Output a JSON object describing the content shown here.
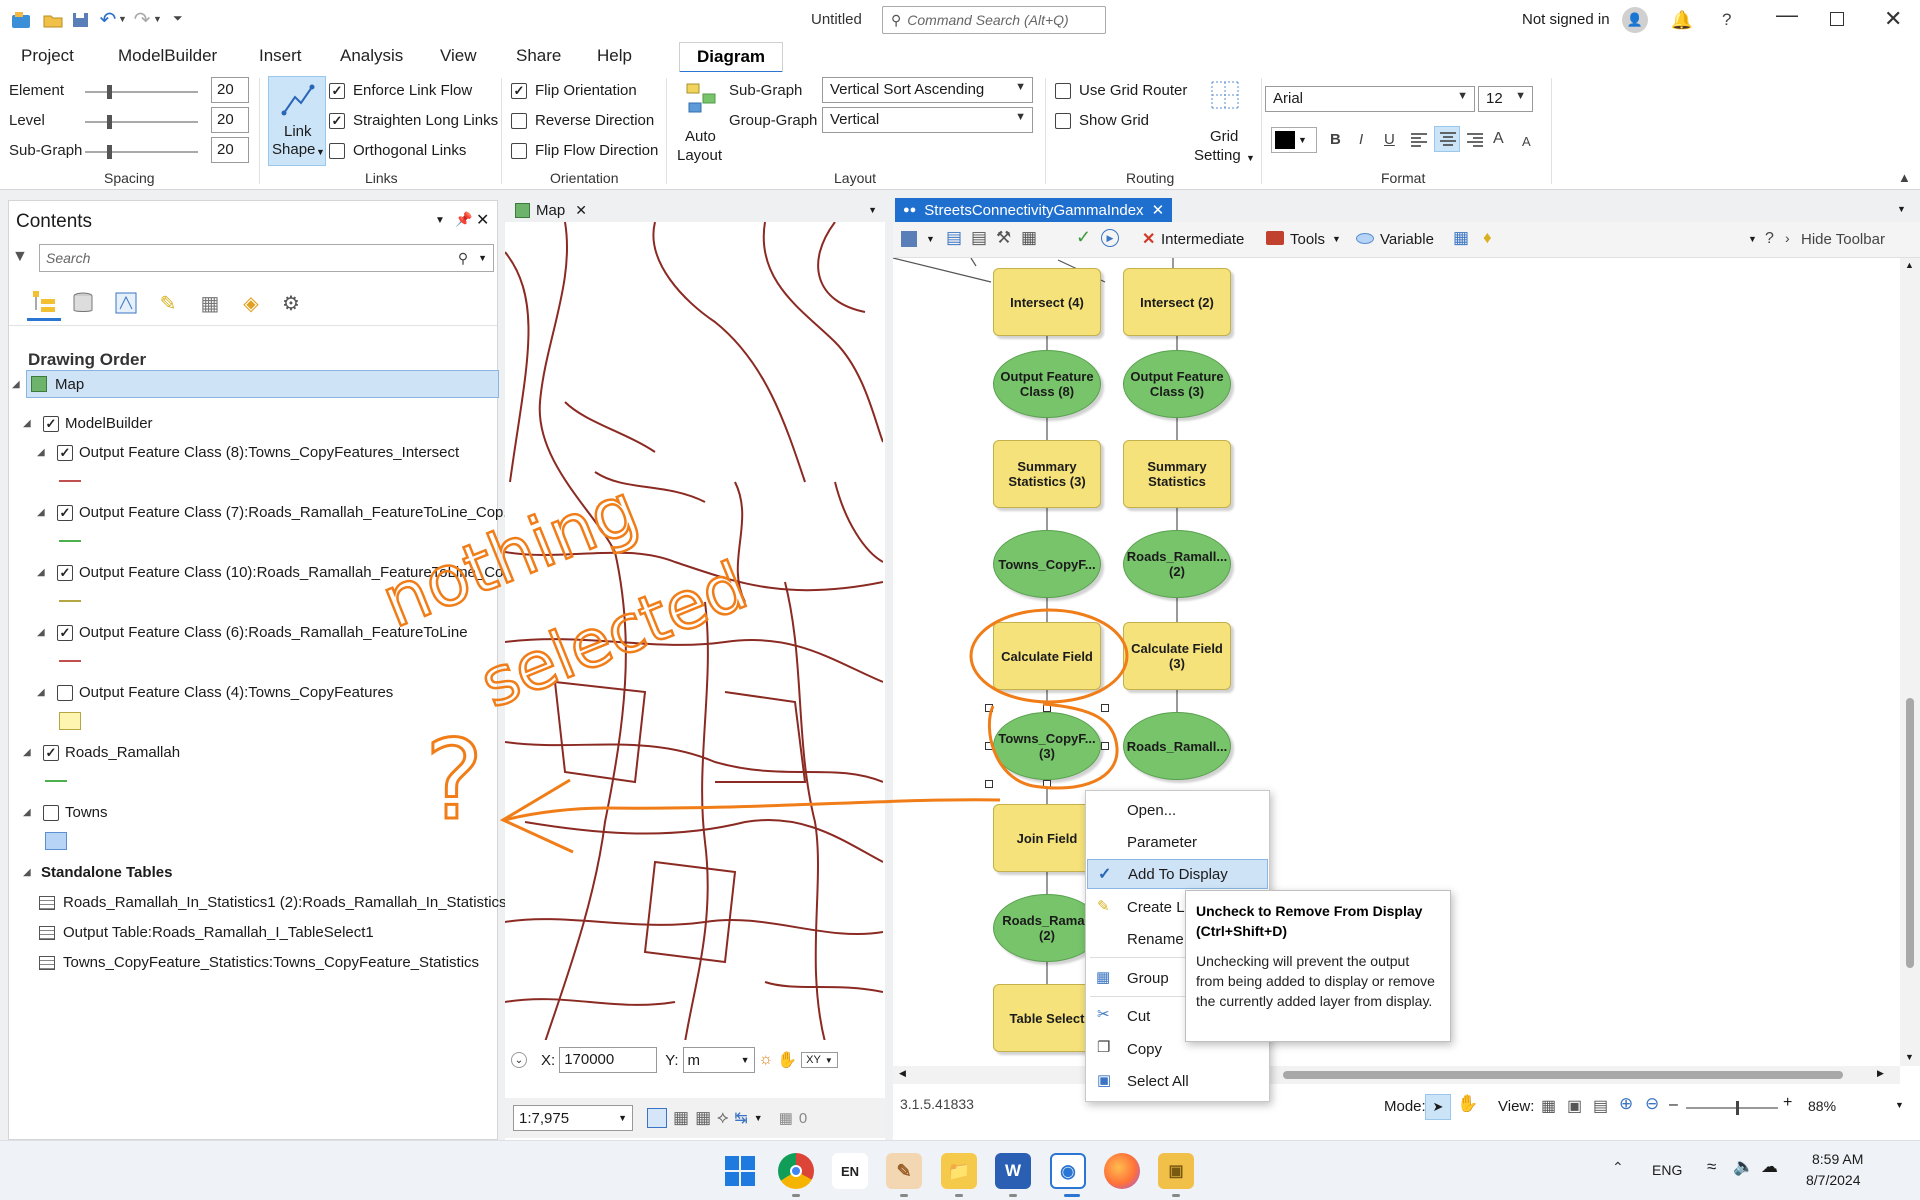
{
  "titlebar": {
    "doc_title": "Untitled",
    "search_placeholder": "Command Search (Alt+Q)",
    "signin": "Not signed in",
    "help": "?"
  },
  "tabs": [
    "Project",
    "ModelBuilder",
    "Insert",
    "Analysis",
    "View",
    "Share",
    "Help",
    "Diagram"
  ],
  "active_tab": "Diagram",
  "ribbon": {
    "spacing": {
      "element_label": "Element",
      "element_value": "20",
      "element_level": 0.25,
      "level_label": "Level",
      "level_value": "20",
      "level_level": 0.25,
      "subgraph_label": "Sub-Graph",
      "subgraph_value": "20",
      "subgraph_level": 0.25,
      "group": "Spacing"
    },
    "links": {
      "link_shape_1": "Link",
      "link_shape_2": "Shape",
      "enforce": "Enforce Link Flow",
      "straighten": "Straighten Long Links",
      "orthogonal": "Orthogonal Links",
      "group": "Links"
    },
    "orientation": {
      "flip": "Flip Orientation",
      "reverse": "Reverse Direction",
      "flip_flow": "Flip Flow Direction",
      "group": "Orientation"
    },
    "layout": {
      "auto_1": "Auto",
      "auto_2": "Layout",
      "subgraph_label": "Sub-Graph",
      "subgraph_value": "Vertical Sort Ascending",
      "groupgraph_label": "Group-Graph",
      "groupgraph_value": "Vertical",
      "group": "Layout"
    },
    "routing": {
      "grid_router": "Use Grid Router",
      "show_grid": "Show Grid",
      "grid_1": "Grid",
      "grid_2": "Setting",
      "group": "Routing"
    },
    "format": {
      "font": "Arial",
      "size": "12",
      "bold": "B",
      "italic": "I",
      "underline": "U",
      "grow": "A",
      "shrink": "A",
      "group": "Format"
    }
  },
  "contents": {
    "title": "Contents",
    "search_placeholder": "Search",
    "drawing_order": "Drawing Order",
    "items": [
      {
        "label": "Map"
      },
      {
        "label": "ModelBuilder"
      },
      {
        "label": "Output Feature Class (8):Towns_CopyFeatures_Intersect"
      },
      {
        "label": "Output Feature Class (7):Roads_Ramallah_FeatureToLine_Cop..."
      },
      {
        "label": "Output Feature Class (10):Roads_Ramallah_FeatureToLine_Co..."
      },
      {
        "label": "Output Feature Class (6):Roads_Ramallah_FeatureToLine"
      },
      {
        "label": "Output Feature Class (4):Towns_CopyFeatures"
      },
      {
        "label": "Roads_Ramallah"
      },
      {
        "label": "Towns"
      },
      {
        "label": "Standalone Tables"
      },
      {
        "label": "Roads_Ramallah_In_Statistics1 (2):Roads_Ramallah_In_Statistics"
      },
      {
        "label": "Output Table:Roads_Ramallah_I_TableSelect1"
      },
      {
        "label": "Towns_CopyFeature_Statistics:Towns_CopyFeature_Statistics"
      }
    ],
    "colors": {
      "red_line": "#c0504d",
      "green_line": "#4caf50",
      "olive_line": "#b5a642",
      "yellow_fill": "#fdf5b0",
      "blue_fill": "#b7d3f5"
    }
  },
  "map": {
    "tab": "Map",
    "x_label": "X:",
    "x_value": "170000",
    "y_label": "Y:",
    "unit": "m",
    "xy": "XY",
    "scale": "1:7,975",
    "zero": "0",
    "annotation_1": "nothing",
    "annotation_2": "selected",
    "annotation_q": "?",
    "road_color": "#8b2a22",
    "annotation_color": "#f07d18"
  },
  "model": {
    "tab": "StreetsConnectivityGammaIndex",
    "intermediate": "Intermediate",
    "tools": "Tools",
    "variable": "Variable",
    "help": "?",
    "hide": "Hide Toolbar",
    "version": "3.1.5.41833",
    "mode": "Mode:",
    "view": "View:",
    "zoom": "88%",
    "nodes": [
      {
        "name": "Intersect (4)"
      },
      {
        "name": "Intersect (2)"
      },
      {
        "name": "Output Feature Class (8)"
      },
      {
        "name": "Output Feature Class (3)"
      },
      {
        "name": "Summary Statistics (3)"
      },
      {
        "name": "Summary Statistics"
      },
      {
        "name": "Towns_CopyF..."
      },
      {
        "name": "Roads_Ramall... (2)"
      },
      {
        "name": "Calculate Field"
      },
      {
        "name": "Calculate Field (3)"
      },
      {
        "name": "Towns_CopyF... (3)"
      },
      {
        "name": "Roads_Ramall..."
      },
      {
        "name": "Join Field"
      },
      {
        "name": "Roads_Ramall (2)"
      },
      {
        "name": "Table Select"
      }
    ]
  },
  "context_menu": {
    "items": [
      "Open...",
      "Parameter",
      "Add To Display",
      "Create La",
      "Rename",
      "Group",
      "Cut",
      "Copy",
      "Select All"
    ]
  },
  "tooltip": {
    "title": "Uncheck to Remove From Display (Ctrl+Shift+D)",
    "body": "Unchecking will prevent the output from being added to display or remove the currently added layer from display."
  },
  "taskbar": {
    "lang": "ENG",
    "time": "8:59 AM",
    "date": "8/7/2024",
    "en": "EN",
    "word": "W"
  }
}
